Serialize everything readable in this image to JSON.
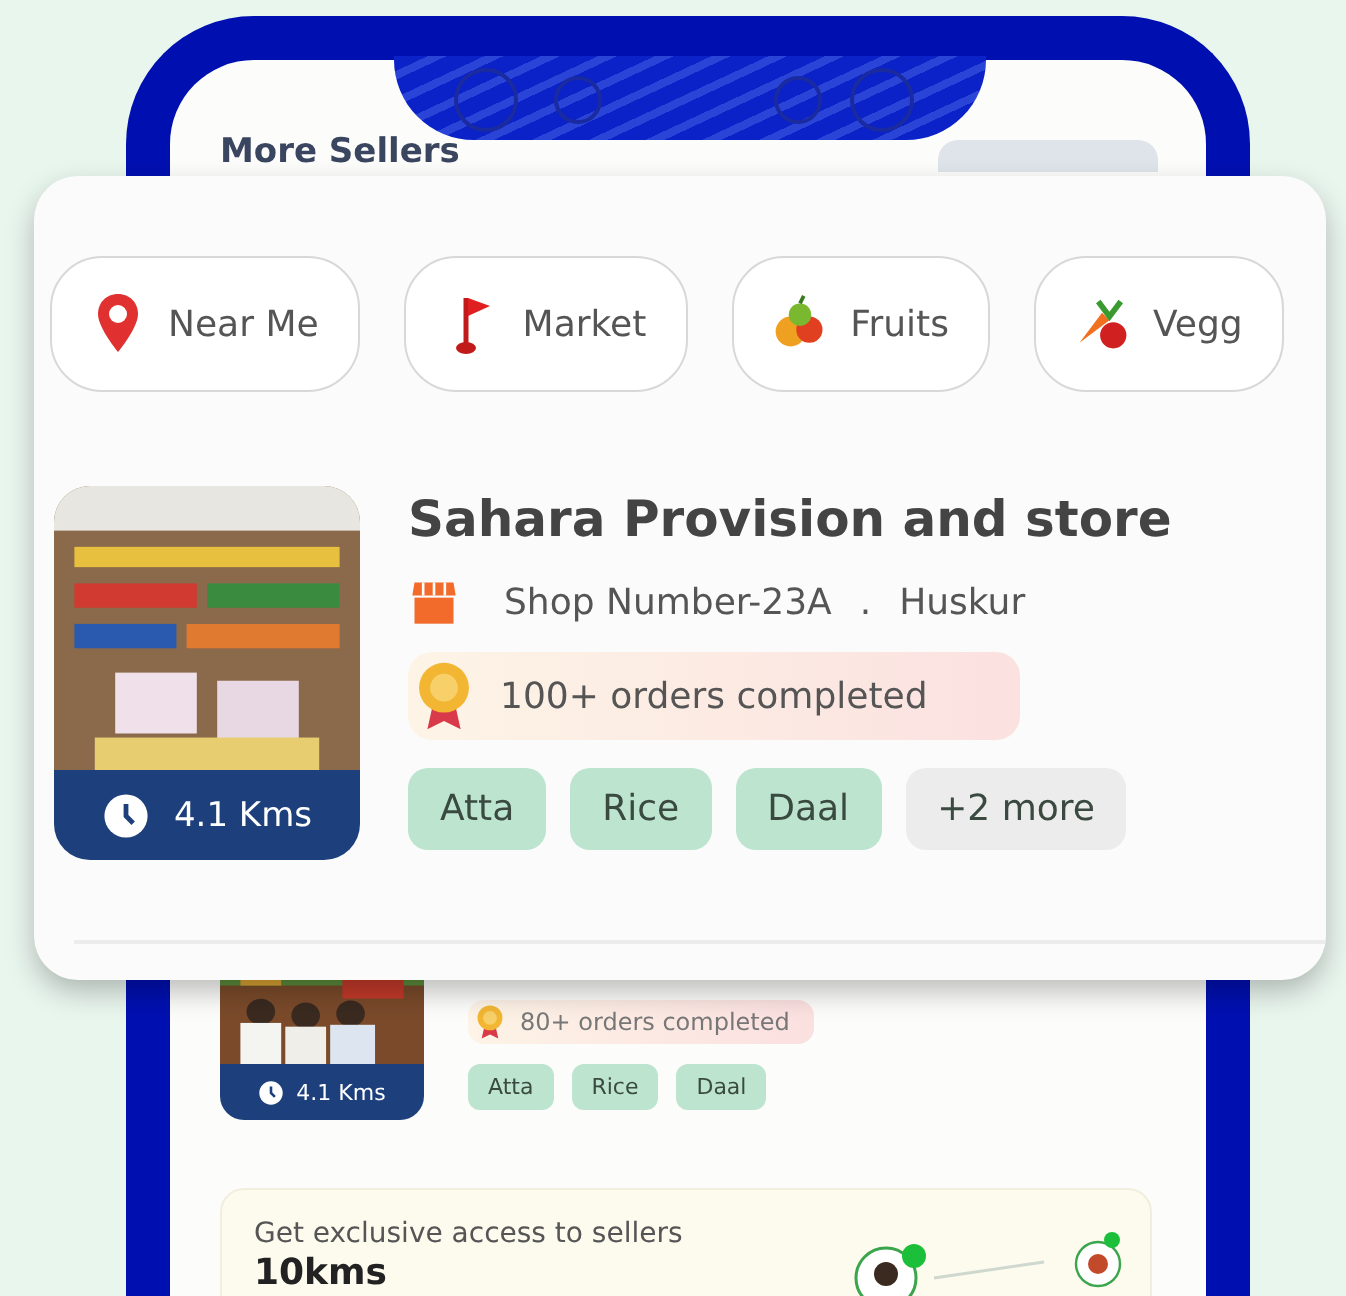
{
  "phone": {
    "section_title": "More Sellers"
  },
  "categories": [
    {
      "label": "Near Me",
      "kind": "pin"
    },
    {
      "label": "Market",
      "kind": "flag"
    },
    {
      "label": "Fruits",
      "kind": "fruits"
    },
    {
      "label": "Vegg",
      "kind": "veggies"
    }
  ],
  "featured_seller": {
    "name": "Sahara Provision and store",
    "address": "Shop Number-23A",
    "separator": ".",
    "locality": "Huskur",
    "orders": "100+ orders completed",
    "distance": "4.1 Kms",
    "tags": [
      "Atta",
      "Rice",
      "Daal"
    ],
    "more": "+2 more"
  },
  "second_seller": {
    "orders": "80+ orders completed",
    "distance": "4.1 Kms",
    "tags": [
      "Atta",
      "Rice",
      "Daal"
    ]
  },
  "promo": {
    "text": "Get exclusive access to sellers",
    "headline": "10kms"
  }
}
